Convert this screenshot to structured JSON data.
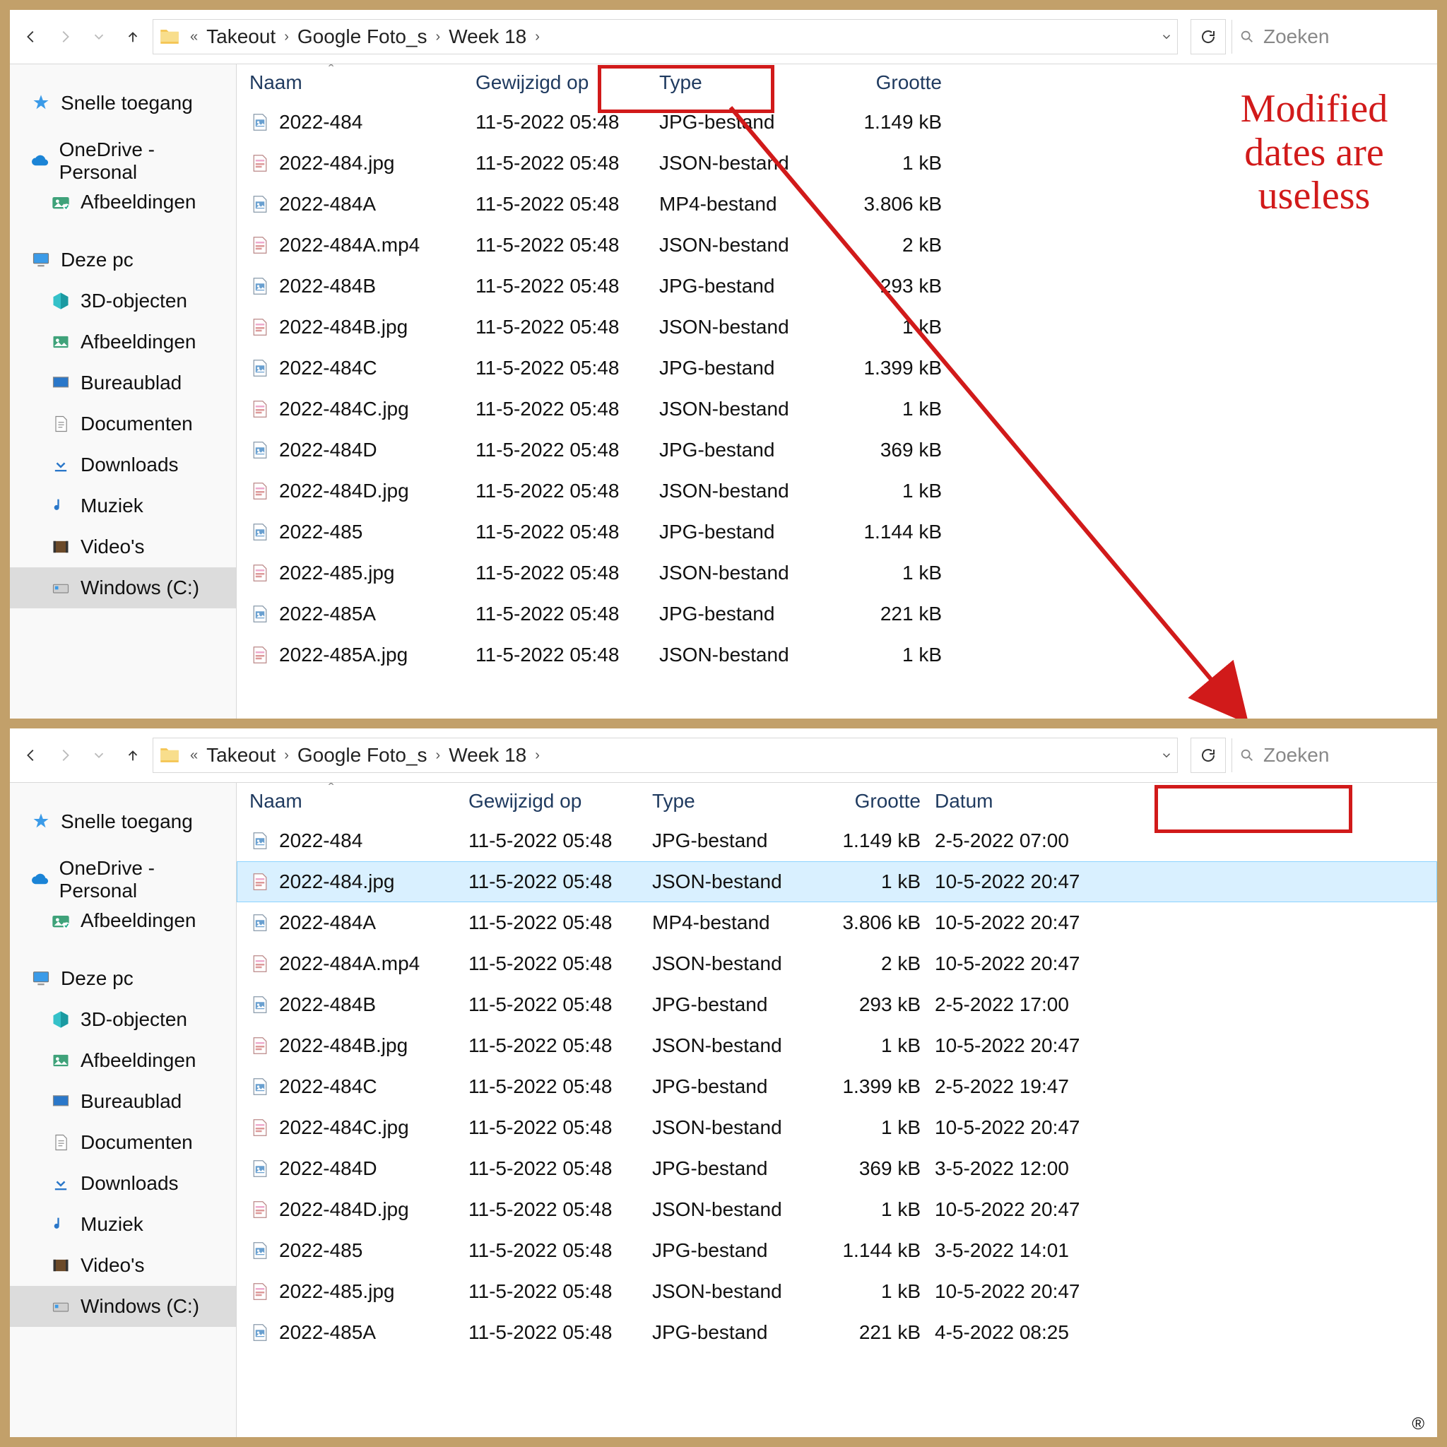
{
  "breadcrumb": {
    "prefix": "«",
    "parts": [
      "Takeout",
      "Google Foto_s",
      "Week 18"
    ]
  },
  "search_placeholder": "Zoeken",
  "sidebar": {
    "quick": "Snelle toegang",
    "onedrive": "OneDrive - Personal",
    "onedrive_child": "Afbeeldingen",
    "thispc": "Deze pc",
    "pc_items": [
      "3D-objecten",
      "Afbeeldingen",
      "Bureaublad",
      "Documenten",
      "Downloads",
      "Muziek",
      "Video's",
      "Windows (C:)"
    ]
  },
  "columns4": [
    "Naam",
    "Gewijzigd op",
    "Type",
    "Grootte"
  ],
  "columns5": [
    "Naam",
    "Gewijzigd op",
    "Type",
    "Grootte",
    "Datum"
  ],
  "top_rows": [
    {
      "icon": "jpg",
      "name": "2022-484",
      "mod": "11-5-2022 05:48",
      "type": "JPG-bestand",
      "size": "1.149 kB"
    },
    {
      "icon": "json",
      "name": "2022-484.jpg",
      "mod": "11-5-2022 05:48",
      "type": "JSON-bestand",
      "size": "1 kB"
    },
    {
      "icon": "jpg",
      "name": "2022-484A",
      "mod": "11-5-2022 05:48",
      "type": "MP4-bestand",
      "size": "3.806 kB"
    },
    {
      "icon": "json",
      "name": "2022-484A.mp4",
      "mod": "11-5-2022 05:48",
      "type": "JSON-bestand",
      "size": "2 kB"
    },
    {
      "icon": "jpg",
      "name": "2022-484B",
      "mod": "11-5-2022 05:48",
      "type": "JPG-bestand",
      "size": "293 kB"
    },
    {
      "icon": "json",
      "name": "2022-484B.jpg",
      "mod": "11-5-2022 05:48",
      "type": "JSON-bestand",
      "size": "1 kB"
    },
    {
      "icon": "jpg",
      "name": "2022-484C",
      "mod": "11-5-2022 05:48",
      "type": "JPG-bestand",
      "size": "1.399 kB"
    },
    {
      "icon": "json",
      "name": "2022-484C.jpg",
      "mod": "11-5-2022 05:48",
      "type": "JSON-bestand",
      "size": "1 kB"
    },
    {
      "icon": "jpg",
      "name": "2022-484D",
      "mod": "11-5-2022 05:48",
      "type": "JPG-bestand",
      "size": "369 kB"
    },
    {
      "icon": "json",
      "name": "2022-484D.jpg",
      "mod": "11-5-2022 05:48",
      "type": "JSON-bestand",
      "size": "1 kB"
    },
    {
      "icon": "jpg",
      "name": "2022-485",
      "mod": "11-5-2022 05:48",
      "type": "JPG-bestand",
      "size": "1.144 kB"
    },
    {
      "icon": "json",
      "name": "2022-485.jpg",
      "mod": "11-5-2022 05:48",
      "type": "JSON-bestand",
      "size": "1 kB"
    },
    {
      "icon": "jpg",
      "name": "2022-485A",
      "mod": "11-5-2022 05:48",
      "type": "JPG-bestand",
      "size": "221 kB"
    },
    {
      "icon": "json",
      "name": "2022-485A.jpg",
      "mod": "11-5-2022 05:48",
      "type": "JSON-bestand",
      "size": "1 kB"
    }
  ],
  "bottom_rows": [
    {
      "icon": "jpg",
      "name": "2022-484",
      "mod": "11-5-2022 05:48",
      "type": "JPG-bestand",
      "size": "1.149 kB",
      "date": "2-5-2022 07:00"
    },
    {
      "icon": "json",
      "name": "2022-484.jpg",
      "mod": "11-5-2022 05:48",
      "type": "JSON-bestand",
      "size": "1 kB",
      "date": "10-5-2022 20:47",
      "sel": true
    },
    {
      "icon": "jpg",
      "name": "2022-484A",
      "mod": "11-5-2022 05:48",
      "type": "MP4-bestand",
      "size": "3.806 kB",
      "date": "10-5-2022 20:47"
    },
    {
      "icon": "json",
      "name": "2022-484A.mp4",
      "mod": "11-5-2022 05:48",
      "type": "JSON-bestand",
      "size": "2 kB",
      "date": "10-5-2022 20:47"
    },
    {
      "icon": "jpg",
      "name": "2022-484B",
      "mod": "11-5-2022 05:48",
      "type": "JPG-bestand",
      "size": "293 kB",
      "date": "2-5-2022 17:00"
    },
    {
      "icon": "json",
      "name": "2022-484B.jpg",
      "mod": "11-5-2022 05:48",
      "type": "JSON-bestand",
      "size": "1 kB",
      "date": "10-5-2022 20:47"
    },
    {
      "icon": "jpg",
      "name": "2022-484C",
      "mod": "11-5-2022 05:48",
      "type": "JPG-bestand",
      "size": "1.399 kB",
      "date": "2-5-2022 19:47"
    },
    {
      "icon": "json",
      "name": "2022-484C.jpg",
      "mod": "11-5-2022 05:48",
      "type": "JSON-bestand",
      "size": "1 kB",
      "date": "10-5-2022 20:47"
    },
    {
      "icon": "jpg",
      "name": "2022-484D",
      "mod": "11-5-2022 05:48",
      "type": "JPG-bestand",
      "size": "369 kB",
      "date": "3-5-2022 12:00"
    },
    {
      "icon": "json",
      "name": "2022-484D.jpg",
      "mod": "11-5-2022 05:48",
      "type": "JSON-bestand",
      "size": "1 kB",
      "date": "10-5-2022 20:47"
    },
    {
      "icon": "jpg",
      "name": "2022-485",
      "mod": "11-5-2022 05:48",
      "type": "JPG-bestand",
      "size": "1.144 kB",
      "date": "3-5-2022 14:01"
    },
    {
      "icon": "json",
      "name": "2022-485.jpg",
      "mod": "11-5-2022 05:48",
      "type": "JSON-bestand",
      "size": "1 kB",
      "date": "10-5-2022 20:47"
    },
    {
      "icon": "jpg",
      "name": "2022-485A",
      "mod": "11-5-2022 05:48",
      "type": "JPG-bestand",
      "size": "221 kB",
      "date": "4-5-2022 08:25"
    }
  ],
  "annotation_text": "Modified dates are useless",
  "annotation_color": "#d11a1a"
}
